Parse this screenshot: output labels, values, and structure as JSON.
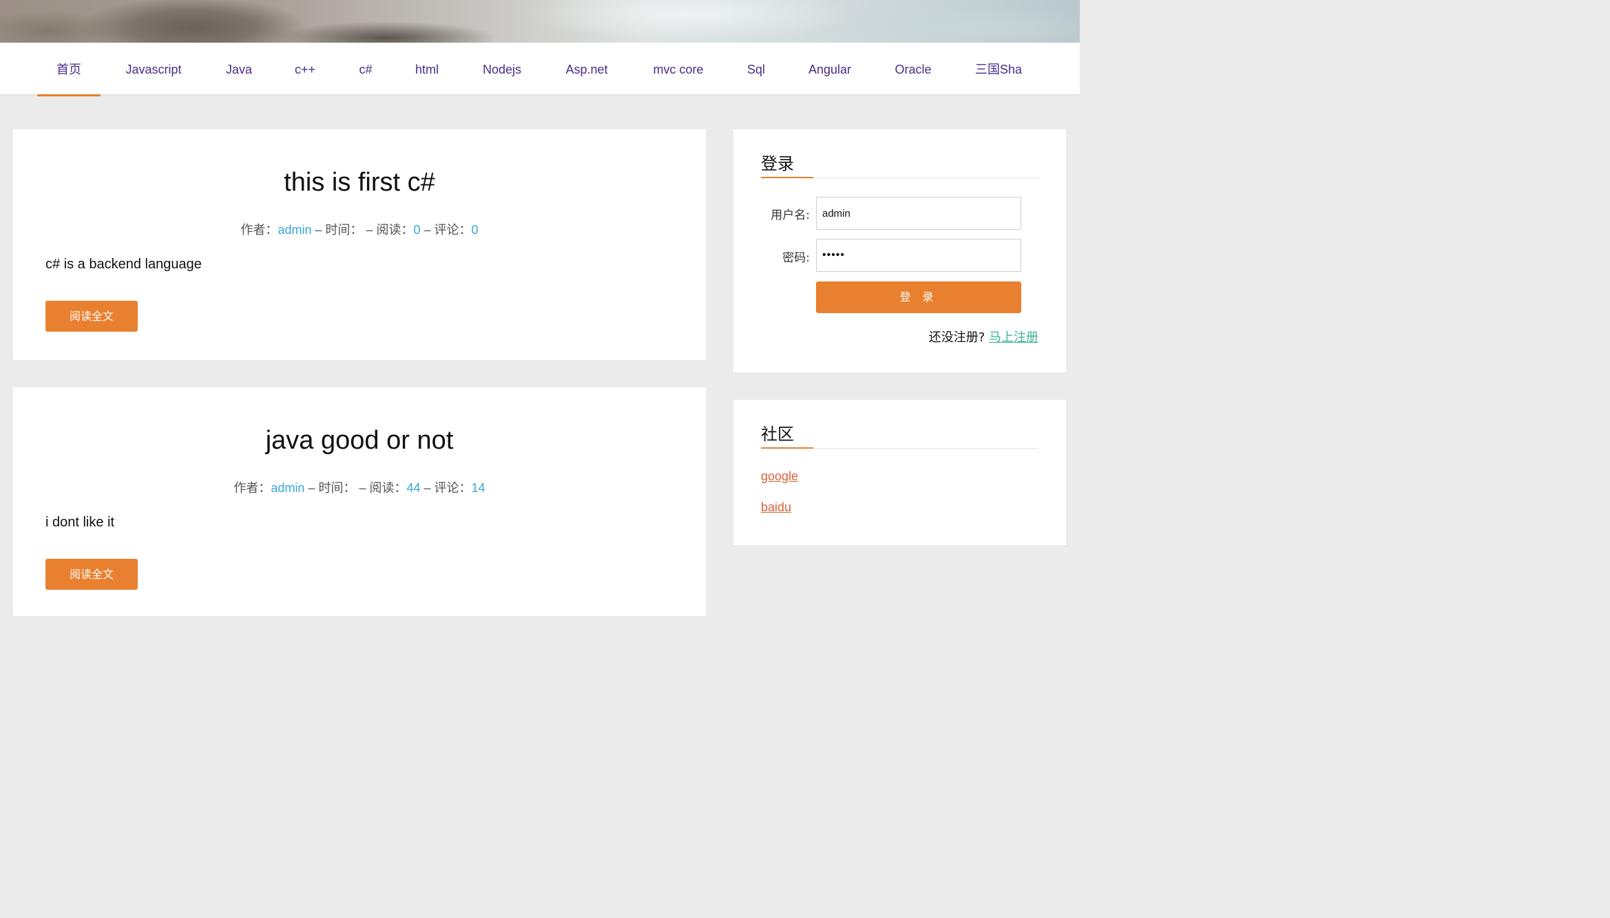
{
  "nav": {
    "items": [
      "首页",
      "Javascript",
      "Java",
      "c++",
      "c#",
      "html",
      "Nodejs",
      "Asp.net",
      "mvc core",
      "Sql",
      "Angular",
      "Oracle",
      "三国Sha"
    ],
    "active_index": 0
  },
  "posts": [
    {
      "title": "this is first c#",
      "author_label": "作者：",
      "author": "admin",
      "time_label": " – 时间：",
      "time": "",
      "reads_label": " – 阅读：",
      "reads": "0",
      "comments_label": " – 评论：",
      "comments": "0",
      "excerpt": "c# is a backend language",
      "button": "阅读全文"
    },
    {
      "title": "java good or not",
      "author_label": "作者：",
      "author": "admin",
      "time_label": " – 时间：",
      "time": "",
      "reads_label": " – 阅读：",
      "reads": "44",
      "comments_label": " – 评论：",
      "comments": "14",
      "excerpt": "i dont like it",
      "button": "阅读全文"
    }
  ],
  "login": {
    "title": "登录",
    "username_label": "用户名:",
    "username_value": "admin",
    "password_label": "密码:",
    "password_value": "•••••",
    "submit": "登 录",
    "register_prompt": "还没注册?",
    "register_link": "马上注册"
  },
  "community": {
    "title": "社区",
    "links": [
      "google",
      "baidu"
    ]
  },
  "colors": {
    "accent": "#e8802f",
    "link_blue": "#3aa7d8",
    "nav_text": "#4a2c8a",
    "register_link": "#39b39a",
    "community_link": "#e0603a"
  }
}
